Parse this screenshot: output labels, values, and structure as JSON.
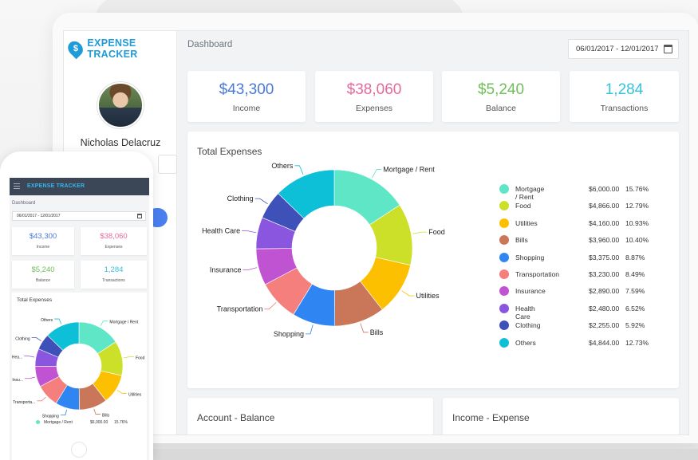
{
  "app": {
    "title": "EXPENSE TRACKER",
    "logo_icon": "dollar-pin-icon",
    "accent": "#1f9bd7"
  },
  "user": {
    "name": "Nicholas Delacruz"
  },
  "header": {
    "title": "Dashboard",
    "date_range": "06/01/2017 - 12/01/2017"
  },
  "stats": [
    {
      "value": "$43,300",
      "label": "Income",
      "color": "#4a78d6"
    },
    {
      "value": "$38,060",
      "label": "Expenses",
      "color": "#e36a9a"
    },
    {
      "value": "$5,240",
      "label": "Balance",
      "color": "#6ebe5a"
    },
    {
      "value": "1,284",
      "label": "Transactions",
      "color": "#35c2dd"
    }
  ],
  "panels": {
    "total_expenses": "Total Expenses",
    "account_balance": "Account - Balance",
    "income_expense": "Income - Expense"
  },
  "chart_data": {
    "type": "pie",
    "title": "Total Expenses",
    "categories": [
      "Mortgage / Rent",
      "Food",
      "Utilities",
      "Bills",
      "Shopping",
      "Transportation",
      "Insurance",
      "Health Care",
      "Clothing",
      "Others"
    ],
    "values": [
      6000,
      4866,
      4160,
      3960,
      3375,
      3230,
      2890,
      2480,
      2255,
      4844
    ],
    "amounts": [
      "$6,000.00",
      "$4,866.00",
      "$4,160.00",
      "$3,960.00",
      "$3,375.00",
      "$3,230.00",
      "$2,890.00",
      "$2,480.00",
      "$2,255.00",
      "$4,844.00"
    ],
    "percents": [
      "15.76%",
      "12.79%",
      "10.93%",
      "10.40%",
      "8.87%",
      "8.49%",
      "7.59%",
      "6.52%",
      "5.92%",
      "12.73%"
    ],
    "colors": [
      "#5ee6c6",
      "#cde029",
      "#fcc000",
      "#c97758",
      "#2f86f3",
      "#f47f7c",
      "#c053d2",
      "#8a56e0",
      "#3e51b8",
      "#0ebfd8"
    ],
    "legend": "right"
  },
  "phone": {
    "logo": "EXPENSE TRACKER",
    "title": "Dashboard",
    "date_range": "06/01/2017 - 12/01/2017",
    "chart_title": "Total Expenses",
    "labels": [
      "Mortgage / Rent",
      "Food",
      "Utilities",
      "Bills",
      "Shopping",
      "Transporta...",
      "Insu...",
      "Hea...",
      "Clothing",
      "Others"
    ],
    "legend_row": {
      "name": "Mortgage / Rent",
      "amount": "$6,000.00",
      "percent": "15.76%"
    }
  }
}
